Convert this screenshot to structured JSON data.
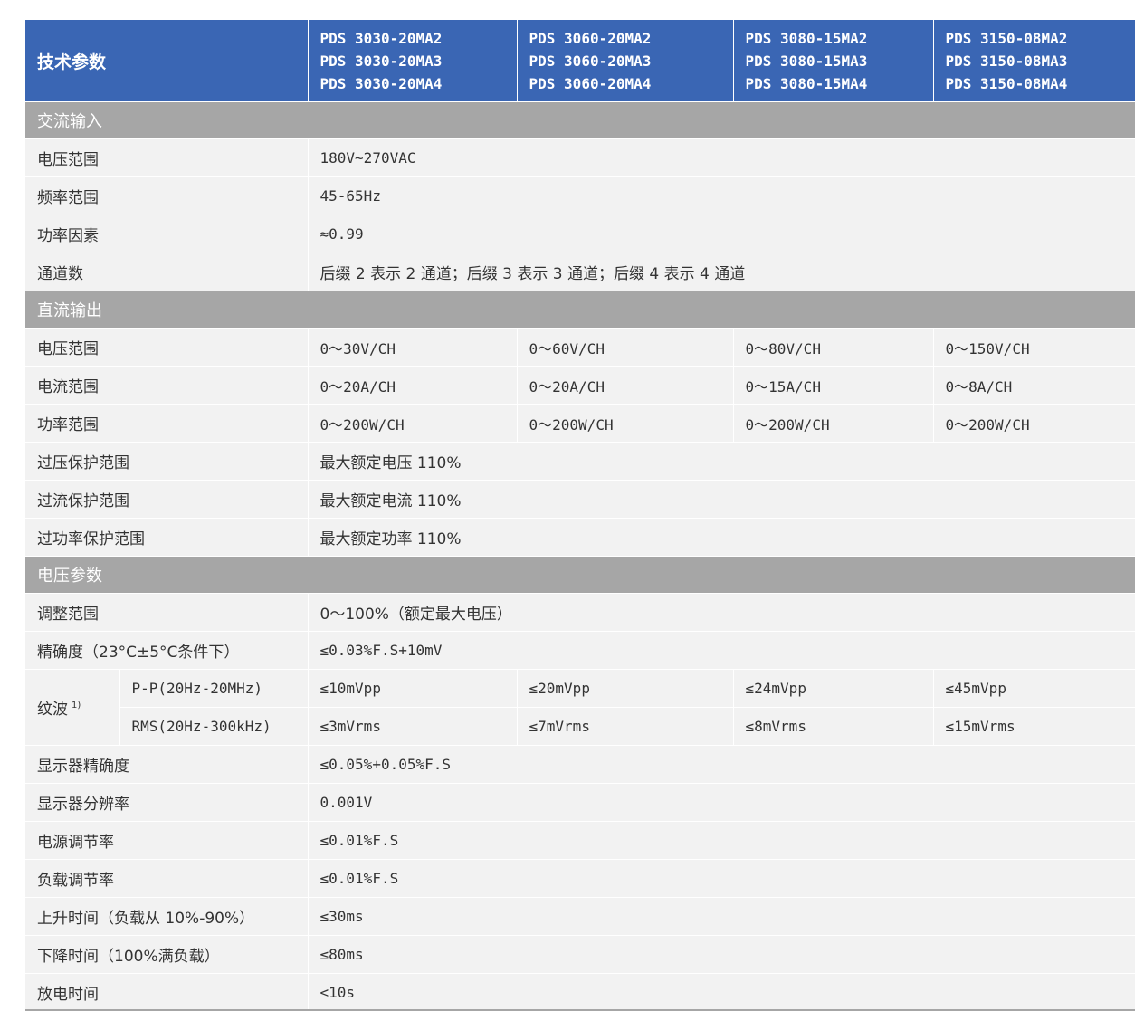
{
  "header": {
    "param_label": "技术参数",
    "models": [
      [
        "PDS 3030-20MA2",
        "PDS 3030-20MA3",
        "PDS 3030-20MA4"
      ],
      [
        "PDS 3060-20MA2",
        "PDS 3060-20MA3",
        "PDS 3060-20MA4"
      ],
      [
        "PDS 3080-15MA2",
        "PDS 3080-15MA3",
        "PDS 3080-15MA4"
      ],
      [
        "PDS 3150-08MA2",
        "PDS 3150-08MA3",
        "PDS 3150-08MA4"
      ]
    ]
  },
  "ac_input": {
    "title": "交流输入",
    "rows": [
      {
        "label": "电压范围",
        "value": "180V~270VAC"
      },
      {
        "label": "频率范围",
        "value": "45-65Hz"
      },
      {
        "label": "功率因素",
        "value": "≈0.99"
      },
      {
        "label": "通道数",
        "value": "后缀 2 表示 2 通道；后缀 3 表示 3 通道；后缀 4 表示 4 通道"
      }
    ]
  },
  "dc_output": {
    "title": "直流输出",
    "multi_rows": [
      {
        "label": "电压范围",
        "values": [
          "0～30V/CH",
          "0～60V/CH",
          "0～80V/CH",
          "0～150V/CH"
        ]
      },
      {
        "label": "电流范围",
        "values": [
          "0～20A/CH",
          "0～20A/CH",
          "0～15A/CH",
          "0～8A/CH"
        ]
      },
      {
        "label": "功率范围",
        "values": [
          "0～200W/CH",
          "0～200W/CH",
          "0～200W/CH",
          "0～200W/CH"
        ]
      }
    ],
    "rows": [
      {
        "label": "过压保护范围",
        "value": "最大额定电压 110%"
      },
      {
        "label": "过流保护范围",
        "value": "最大额定电流 110%"
      },
      {
        "label": "过功率保护范围",
        "value": "最大额定功率 110%"
      }
    ]
  },
  "voltage_params": {
    "title": "电压参数",
    "rows_top": [
      {
        "label": "调整范围",
        "value": "0～100%（额定最大电压）"
      },
      {
        "label": "精确度（23°C±5°C条件下）",
        "value": "≤0.03%F.S+10mV"
      }
    ],
    "ripple": {
      "label": "纹波",
      "note": "1)",
      "rows": [
        {
          "sublabel": "P-P(20Hz-20MHz)",
          "values": [
            "≤10mVpp",
            "≤20mVpp",
            "≤24mVpp",
            "≤45mVpp"
          ]
        },
        {
          "sublabel": "RMS(20Hz-300kHz)",
          "values": [
            "≤3mVrms",
            "≤7mVrms",
            "≤8mVrms",
            "≤15mVrms"
          ]
        }
      ]
    },
    "rows_bottom": [
      {
        "label": "显示器精确度",
        "value": "≤0.05%+0.05%F.S"
      },
      {
        "label": "显示器分辨率",
        "value": "0.001V"
      },
      {
        "label": "电源调节率",
        "value": "≤0.01%F.S"
      },
      {
        "label": "负载调节率",
        "value": "≤0.01%F.S"
      },
      {
        "label": "上升时间（负载从 10%-90%）",
        "value": "≤30ms"
      },
      {
        "label": "下降时间（100%满负载）",
        "value": "≤80ms"
      },
      {
        "label": "放电时间",
        "value": "<10s"
      }
    ]
  },
  "colors": {
    "header_bg": "#3a66b4",
    "section_bg": "#a6a6a6",
    "row_bg": "#f2f2f2",
    "text": "#333333"
  }
}
